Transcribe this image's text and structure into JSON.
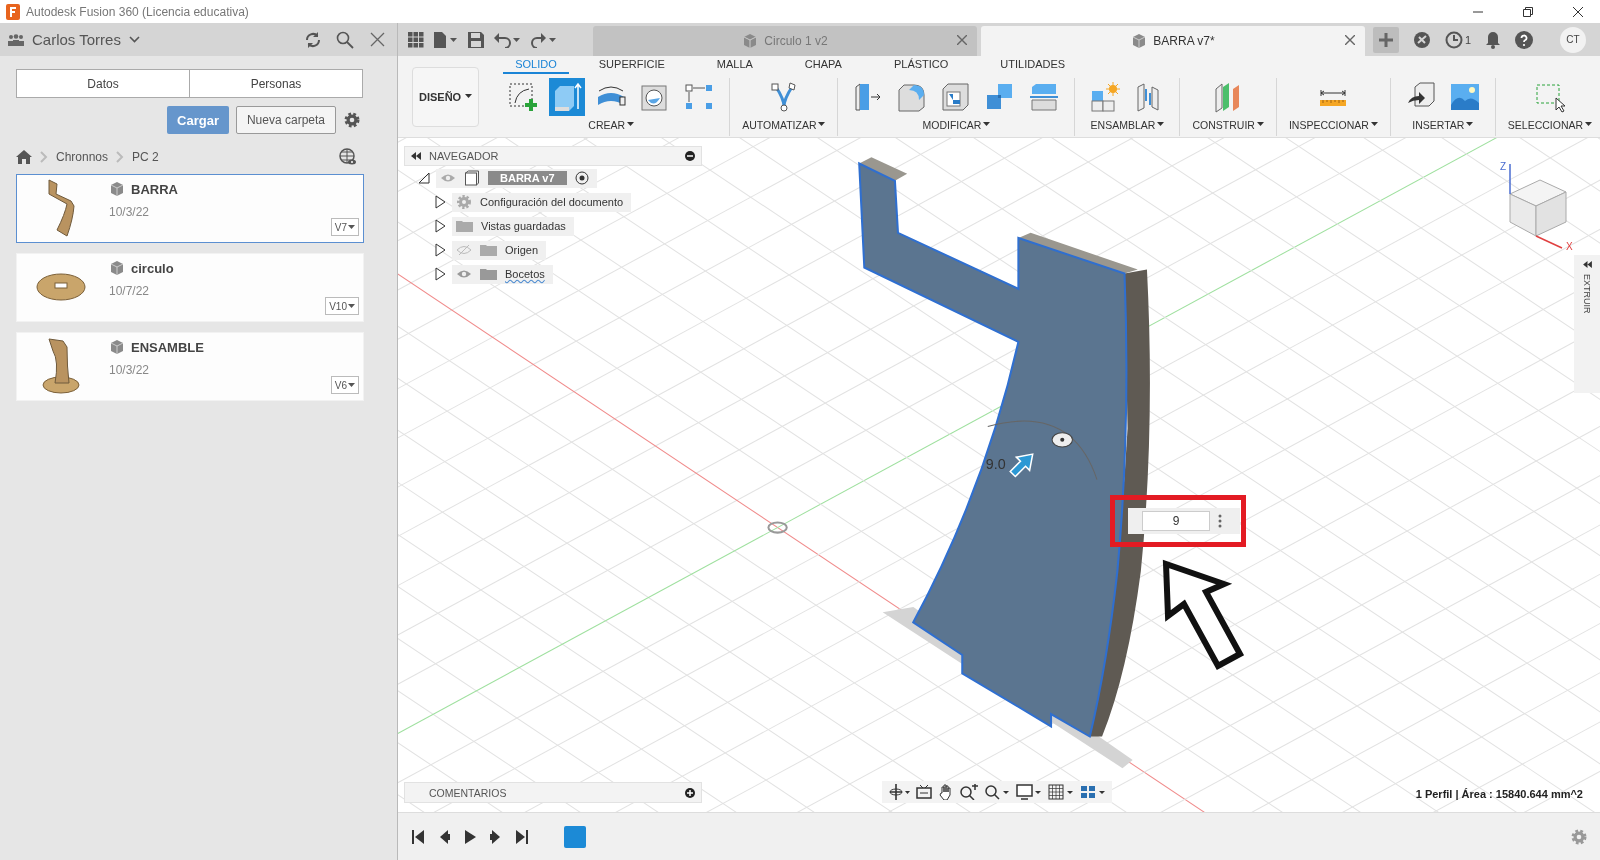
{
  "window": {
    "title": "Autodesk Fusion 360 (Licencia educativa)"
  },
  "data_panel": {
    "user": "Carlos Torres",
    "tabs": [
      "Datos",
      "Personas"
    ],
    "upload_button": "Cargar",
    "new_folder_button": "Nueva carpeta",
    "breadcrumb": [
      "Chronnos",
      "PC 2"
    ],
    "files": [
      {
        "name": "BARRA",
        "date": "10/3/22",
        "version": "V7",
        "selected": true,
        "kind": "bar"
      },
      {
        "name": "circulo",
        "date": "10/7/22",
        "version": "V10",
        "selected": false,
        "kind": "disk"
      },
      {
        "name": "ENSAMBLE",
        "date": "10/3/22",
        "version": "V6",
        "selected": false,
        "kind": "stand"
      }
    ]
  },
  "document_tabs": [
    {
      "label": "Circulo 1 v2",
      "selected": false
    },
    {
      "label": "BARRA v7*",
      "selected": true
    }
  ],
  "jobs_count": "1",
  "avatar": "CT",
  "workspace": "DISEÑO",
  "toolbar_tabs": [
    {
      "label": "SOLIDO",
      "selected": true
    },
    {
      "label": "SUPERFICIE",
      "selected": false
    },
    {
      "label": "MALLA",
      "selected": false
    },
    {
      "label": "CHAPA",
      "selected": false
    },
    {
      "label": "PLÁSTICO",
      "selected": false
    },
    {
      "label": "UTILIDADES",
      "selected": false
    }
  ],
  "tool_groups": [
    {
      "label": "CREAR",
      "tools": [
        {
          "kind": "sketch",
          "active": false
        },
        {
          "kind": "extrude",
          "active": true
        },
        {
          "kind": "revolve",
          "active": false
        },
        {
          "kind": "hole",
          "active": false
        },
        {
          "kind": "pattern",
          "active": false
        }
      ]
    },
    {
      "label": "AUTOMATIZAR",
      "tools": [
        {
          "kind": "automate",
          "active": false
        }
      ]
    },
    {
      "label": "MODIFICAR",
      "tools": [
        {
          "kind": "presspull",
          "active": false
        },
        {
          "kind": "fillet",
          "active": false
        },
        {
          "kind": "shell",
          "active": false
        },
        {
          "kind": "combine",
          "active": false
        },
        {
          "kind": "stacked",
          "active": false
        }
      ]
    },
    {
      "label": "ENSAMBLAR",
      "tools": [
        {
          "kind": "component",
          "active": false
        },
        {
          "kind": "joint",
          "active": false
        }
      ]
    },
    {
      "label": "CONSTRUIR",
      "tools": [
        {
          "kind": "plane",
          "active": false
        }
      ]
    },
    {
      "label": "INSPECCIONAR",
      "tools": [
        {
          "kind": "measure",
          "active": false
        }
      ]
    },
    {
      "label": "INSERTAR",
      "tools": [
        {
          "kind": "insert",
          "active": false
        },
        {
          "kind": "image",
          "active": false
        }
      ]
    },
    {
      "label": "SELECCIONAR",
      "tools": [
        {
          "kind": "select",
          "active": false
        }
      ]
    }
  ],
  "navigator": {
    "title": "NAVEGADOR",
    "root": {
      "label": "BARRA v7",
      "expanded": true,
      "children": [
        {
          "label": "Configuración del documento",
          "kind": "settings",
          "expanded": false
        },
        {
          "label": "Vistas guardadas",
          "kind": "folder",
          "expanded": false
        },
        {
          "label": "Origen",
          "kind": "folder",
          "expanded": false,
          "visible": false
        },
        {
          "label": "Bocetos",
          "kind": "sketches",
          "expanded": false,
          "visible": true
        }
      ]
    }
  },
  "view_cube": {
    "z_axis": "Z",
    "x_axis": "X"
  },
  "dimension": {
    "label": "9.0",
    "input": "9"
  },
  "side_panel": "EXTRUIR",
  "comments": "COMENTARIOS",
  "status": "1 Perfil | Área : 15840.644 mm^2"
}
